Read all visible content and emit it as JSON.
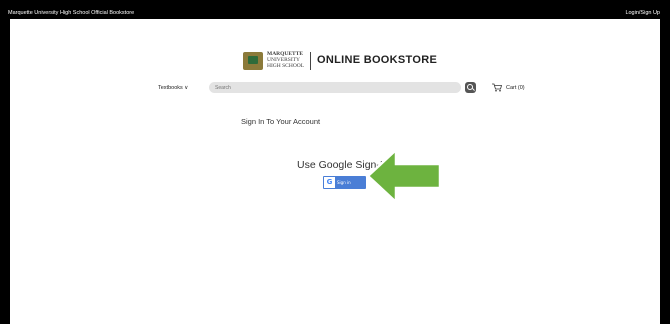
{
  "topbar": {
    "site_title": "Marquette University High School Official Bookstore",
    "login_link": "Login/Sign Up"
  },
  "header": {
    "school_line1": "MARQUETTE",
    "school_line2": "UNIVERSITY",
    "school_line3": "HIGH SCHOOL",
    "store_name": "ONLINE BOOKSTORE"
  },
  "nav": {
    "textbooks_label": "Textbooks ∨",
    "search_placeholder": "Search",
    "cart_label": "Cart (0)"
  },
  "main": {
    "heading": "Sign In To Your Account",
    "google_title": "Use Google Sign-I",
    "google_button_g": "G",
    "google_button_label": "Sign in"
  },
  "colors": {
    "arrow_fill": "#6db33f",
    "google_blue": "#4a7ed6"
  },
  "icons": [
    "shield-crest-icon",
    "search-icon",
    "cart-icon",
    "google-g-icon",
    "left-arrow-icon"
  ]
}
